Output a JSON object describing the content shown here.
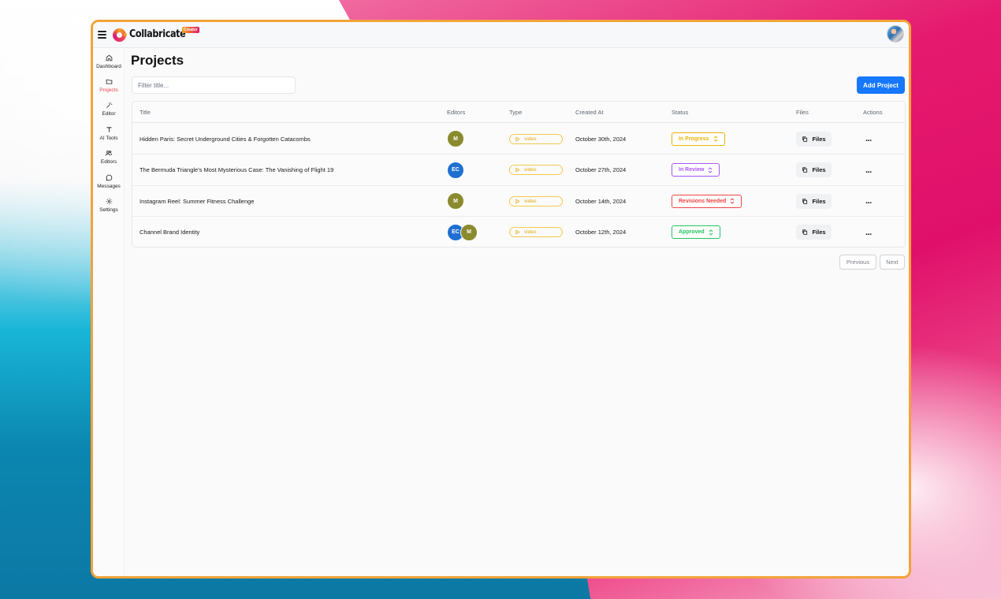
{
  "app": {
    "name": "Collabricate",
    "badge": "Creator"
  },
  "sidebar": {
    "items": [
      {
        "label": "Dashboard",
        "icon": "home-icon",
        "active": false
      },
      {
        "label": "Projects",
        "icon": "folder-icon",
        "active": true
      },
      {
        "label": "Editor",
        "icon": "magic-wand-icon",
        "active": false
      },
      {
        "label": "AI Tools",
        "icon": "text-icon",
        "active": false
      },
      {
        "label": "Editors",
        "icon": "users-icon",
        "active": false
      },
      {
        "label": "Messages",
        "icon": "message-icon",
        "active": false
      },
      {
        "label": "Settings",
        "icon": "gear-icon",
        "active": false
      }
    ]
  },
  "page": {
    "title": "Projects"
  },
  "filter": {
    "placeholder": "Filter title...",
    "value": ""
  },
  "actions": {
    "add_project": "Add Project"
  },
  "table": {
    "headers": [
      "Title",
      "Editors",
      "Type",
      "Created At",
      "Status",
      "Files",
      "Actions"
    ],
    "rows": [
      {
        "title": "Hidden Paris: Secret Underground Cities & Forgotten Catacombs",
        "editors": [
          {
            "initials": "M",
            "color": "#8a8a2e"
          }
        ],
        "type": "video",
        "created_at": "October 30th, 2024",
        "status": "In Progress",
        "status_color": "#eab308",
        "files_label": "Files",
        "actions_label": "..."
      },
      {
        "title": "The Bermuda Triangle's Most Mysterious Case: The Vanishing of Flight 19",
        "editors": [
          {
            "initials": "EC",
            "color": "#1f6fd1"
          }
        ],
        "type": "video",
        "created_at": "October 27th, 2024",
        "status": "In Review",
        "status_color": "#a855f7",
        "files_label": "Files",
        "actions_label": "..."
      },
      {
        "title": "Instagram Reel: Summer Fitness Challenge",
        "editors": [
          {
            "initials": "M",
            "color": "#8a8a2e"
          }
        ],
        "type": "video",
        "created_at": "October 14th, 2024",
        "status": "Revisions Needed",
        "status_color": "#ef4444",
        "files_label": "Files",
        "actions_label": "..."
      },
      {
        "title": "Channel Brand Identity",
        "editors": [
          {
            "initials": "EC",
            "color": "#1f6fd1"
          },
          {
            "initials": "M",
            "color": "#8a8a2e"
          }
        ],
        "type": "video",
        "created_at": "October 12th, 2024",
        "status": "Approved",
        "status_color": "#22c55e",
        "files_label": "Files",
        "actions_label": "..."
      }
    ]
  },
  "pagination": {
    "previous": "Previous",
    "next": "Next"
  },
  "colors": {
    "accent": "#1677ff",
    "window_border": "#f2a33a",
    "active_nav": "#ef4444",
    "type_pill": "#f3c84b"
  }
}
